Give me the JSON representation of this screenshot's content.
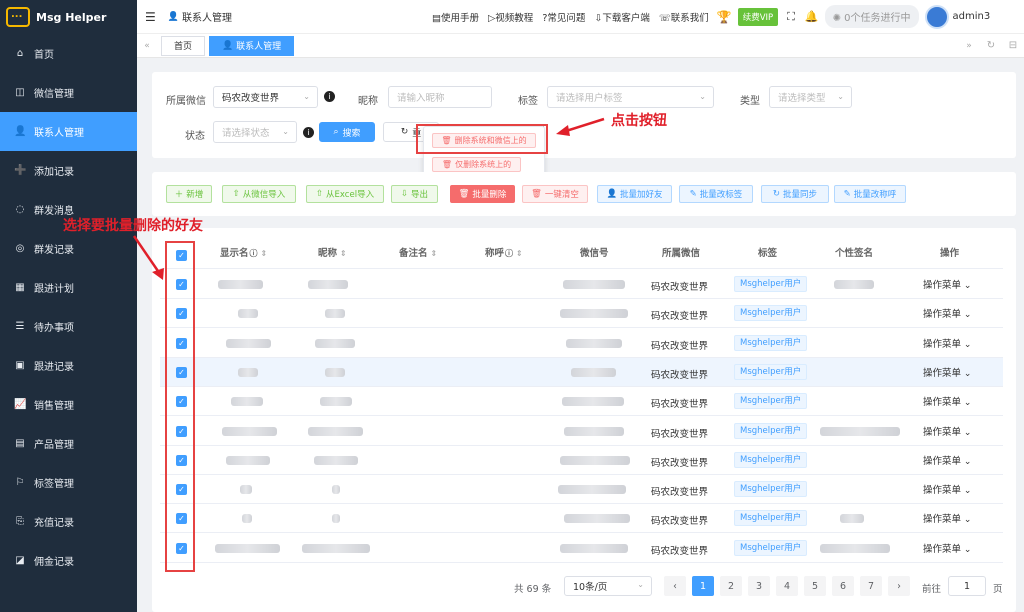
{
  "app": {
    "title": "Msg Helper"
  },
  "sidebar": {
    "items": [
      {
        "label": "首页",
        "icon": "home-icon"
      },
      {
        "label": "微信管理",
        "icon": "wechat-icon"
      },
      {
        "label": "联系人管理",
        "icon": "user-icon",
        "active": true
      },
      {
        "label": "添加记录",
        "icon": "add-user-icon"
      },
      {
        "label": "群发消息",
        "icon": "message-icon"
      },
      {
        "label": "群发记录",
        "icon": "chat-icon"
      },
      {
        "label": "跟进计划",
        "icon": "calendar-icon"
      },
      {
        "label": "待办事项",
        "icon": "list-icon"
      },
      {
        "label": "跟进记录",
        "icon": "briefcase-icon"
      },
      {
        "label": "销售管理",
        "icon": "chart-icon"
      },
      {
        "label": "产品管理",
        "icon": "product-icon"
      },
      {
        "label": "标签管理",
        "icon": "bookmark-icon"
      },
      {
        "label": "充值记录",
        "icon": "recharge-icon"
      },
      {
        "label": "佣金记录",
        "icon": "commission-icon"
      }
    ]
  },
  "header": {
    "breadcrumb": "联系人管理",
    "links": [
      "使用手册",
      "视频教程",
      "常见问题",
      "下载客户端",
      "联系我们"
    ],
    "vip": "续费VIP",
    "tasks": "0个任务进行中",
    "user": "admin3"
  },
  "tabs": [
    "首页",
    "联系人管理"
  ],
  "filters": {
    "wechat_label": "所属微信",
    "wechat_value": "码农改变世界",
    "nick_label": "昵称",
    "nick_placeholder": "请输入昵称",
    "tag_label": "标签",
    "tag_placeholder": "请选择用户标签",
    "type_label": "类型",
    "type_placeholder": "请选择类型",
    "status_label": "状态",
    "status_placeholder": "请选择状态",
    "search": "搜索",
    "reset": "重"
  },
  "dropdown": {
    "opt1": "删除系统和微信上的",
    "opt2": "仅删除系统上的"
  },
  "toolbar": [
    "新增",
    "从微信导入",
    "从Excel导入",
    "导出",
    "批量删除",
    "一键清空",
    "批量加好友",
    "批量改标签",
    "批量同步",
    "批量改称呼"
  ],
  "table": {
    "headers": [
      "显示名",
      "昵称",
      "备注名",
      "称呼",
      "微信号",
      "所属微信",
      "标签",
      "个性签名",
      "操作"
    ],
    "wechat": "码农改变世界",
    "tag": "Msghelper用户",
    "op": "操作菜单",
    "row_count": 10
  },
  "pagination": {
    "total": "共 69 条",
    "size": "10条/页",
    "pages": [
      "1",
      "2",
      "3",
      "4",
      "5",
      "6",
      "7"
    ],
    "goto": "前往",
    "page": "1",
    "page_unit": "页"
  },
  "annotations": {
    "click": "点击按钮",
    "select": "选择要批量删除的好友"
  }
}
